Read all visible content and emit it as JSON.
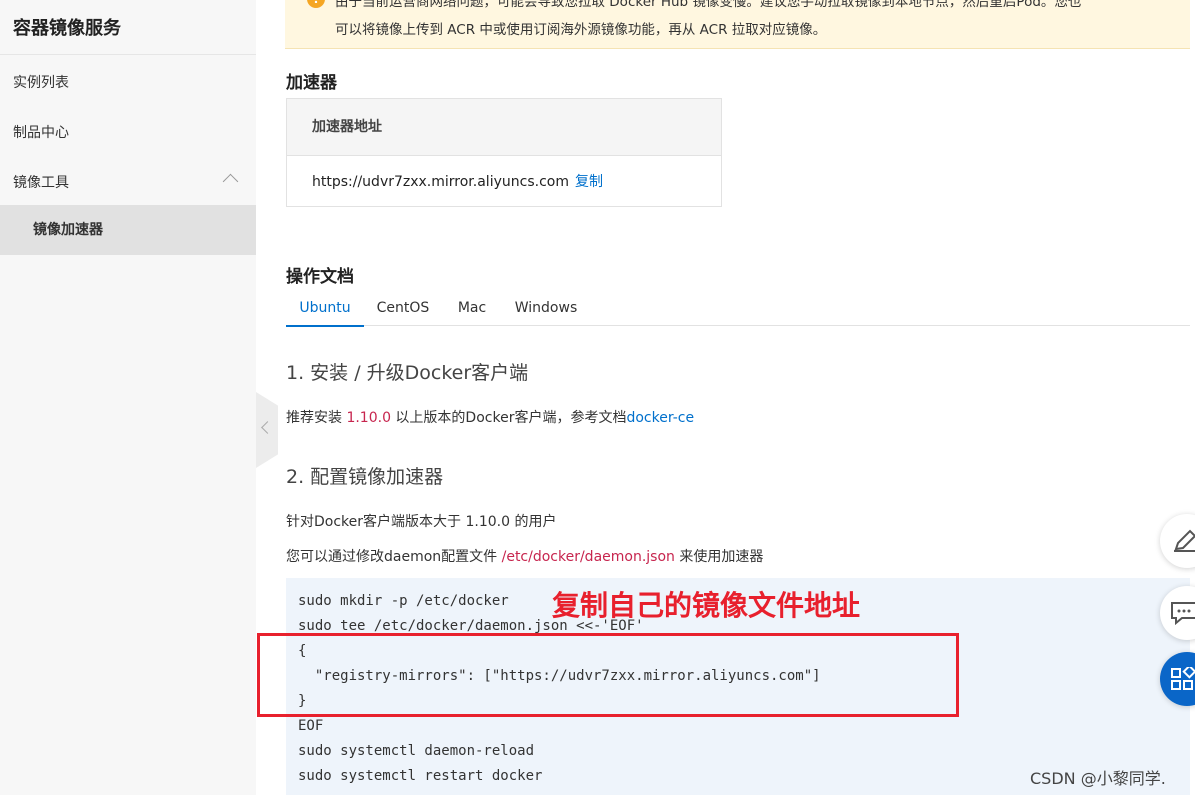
{
  "sidebar": {
    "title": "容器镜像服务",
    "items": [
      {
        "label": "实例列表"
      },
      {
        "label": "制品中心"
      },
      {
        "label": "镜像工具"
      },
      {
        "label": "镜像加速器"
      }
    ]
  },
  "notice": {
    "line1": "由于当前运营商网络问题，可能会导致您拉取 Docker Hub 镜像变慢。建议您手动拉取镜像到本地节点，然后重启Pod。您也",
    "line2": "可以将镜像上传到 ACR 中或使用订阅海外源镜像功能，再从 ACR 拉取对应镜像。"
  },
  "accelerator": {
    "heading": "加速器",
    "column_header": "加速器地址",
    "address": "https://udvr7zxx.mirror.aliyuncs.com",
    "copy_label": "复制"
  },
  "docs": {
    "heading": "操作文档",
    "tabs": [
      {
        "label": "Ubuntu"
      },
      {
        "label": "CentOS"
      },
      {
        "label": "Mac"
      },
      {
        "label": "Windows"
      }
    ],
    "step1_title": "1. 安装 / 升级Docker客户端",
    "step1_pre": "推荐安装 ",
    "step1_version": "1.10.0",
    "step1_mid": " 以上版本的Docker客户端，参考文档",
    "step1_link": "docker-ce",
    "step2_title": "2. 配置镜像加速器",
    "step2_p1": "针对Docker客户端版本大于 1.10.0 的用户",
    "step2_p2_pre": "您可以通过修改daemon配置文件 ",
    "step2_p2_path": "/etc/docker/daemon.json",
    "step2_p2_post": " 来使用加速器"
  },
  "code_lines": [
    "sudo mkdir -p /etc/docker",
    "sudo tee /etc/docker/daemon.json <<-'EOF'",
    "{",
    "  \"registry-mirrors\": [\"https://udvr7zxx.mirror.aliyuncs.com\"]",
    "}",
    "EOF",
    "sudo systemctl daemon-reload",
    "sudo systemctl restart docker"
  ],
  "annotation": "复制自己的镜像文件地址",
  "watermark": "CSDN @小黎同学.",
  "colors": {
    "accent": "#0070cc",
    "annotation": "#e8202d"
  }
}
